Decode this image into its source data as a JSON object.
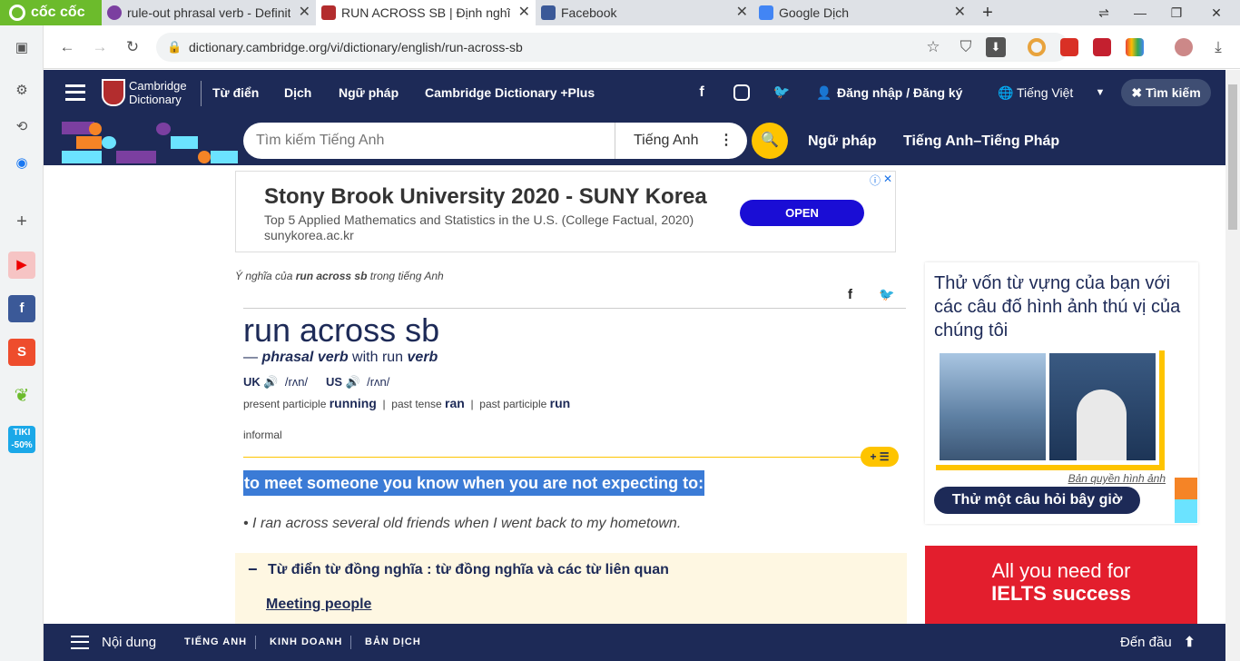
{
  "tabs": {
    "brand": "cốc cốc",
    "items": [
      {
        "title": "rule-out phrasal verb - Definit",
        "fav_color": "#7b3fa0"
      },
      {
        "title": "RUN ACROSS SB | Định nghĩa",
        "fav_color": "#b32d2e"
      },
      {
        "title": "Facebook",
        "fav_color": "#3b5998"
      },
      {
        "title": "Google Dịch",
        "fav_color": "#4285f4"
      }
    ]
  },
  "toolbar": {
    "url": "dictionary.cambridge.org/vi/dictionary/english/run-across-sb"
  },
  "site": {
    "logo_line1": "Cambridge",
    "logo_line2": "Dictionary",
    "nav": [
      "Từ điển",
      "Dịch",
      "Ngữ pháp",
      "Cambridge Dictionary +Plus"
    ],
    "login": "Đăng nhập / Đăng ký",
    "language": "Tiếng Việt",
    "search_label": "Tìm kiếm",
    "search_placeholder": "Tìm kiếm Tiếng Anh",
    "search_lang": "Tiếng Anh",
    "subnav": [
      "Ngữ pháp",
      "Tiếng Anh–Tiếng Pháp"
    ]
  },
  "ad": {
    "headline": "Stony Brook University 2020 - SUNY Korea",
    "sub": "Top 5 Applied Mathematics and Statistics in the U.S. (College Factual, 2020)",
    "domain": "sunykorea.ac.kr",
    "button": "OPEN"
  },
  "entry": {
    "breadcrumb_pre": "Ý nghĩa của ",
    "breadcrumb_word": "run across sb",
    "breadcrumb_post": " trong tiếng Anh",
    "headword": "run across sb",
    "pos_dash": "— ",
    "pos": "phrasal verb",
    "pos_with": " with run ",
    "pos_verb": "verb",
    "uk": "UK",
    "uk_ipa": "/rʌn/",
    "us": "US",
    "us_ipa": "/rʌn/",
    "forms": [
      {
        "label": "present participle",
        "value": "running"
      },
      {
        "label": "past tense",
        "value": "ran"
      },
      {
        "label": "past participle",
        "value": "run"
      }
    ],
    "register": "informal",
    "definition": "to meet someone you know when you are not expecting to:",
    "example": "I ran across several old friends when I went back to my hometown.",
    "thesaurus_title": "Từ điển từ đồng nghĩa : từ đồng nghĩa và các từ liên quan",
    "thesaurus_link": "Meeting people"
  },
  "quiz": {
    "text": "Thử vốn từ vựng của bạn với các câu đố hình ảnh thú vị của chúng tôi",
    "copyright": "Bản quyền hình ảnh",
    "button": "Thử một câu hỏi bây giờ"
  },
  "promo": {
    "line1": "All you need for",
    "line2": "IELTS success"
  },
  "bottom": {
    "contents": "Nội dung",
    "links": [
      "TIẾNG ANH",
      "KINH DOANH",
      "BẢN DỊCH"
    ],
    "top": "Đến đầu"
  }
}
